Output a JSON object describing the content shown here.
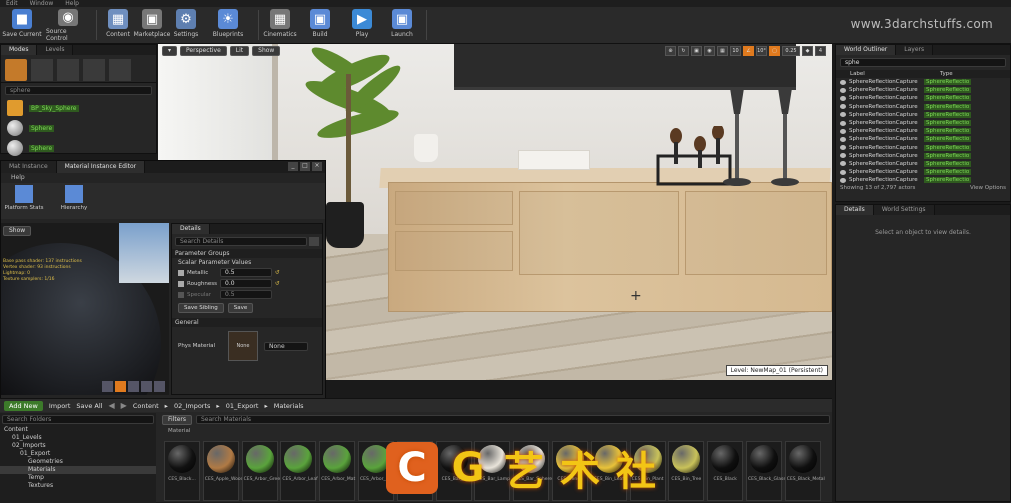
{
  "menu": [
    "Edit",
    "Window",
    "Help"
  ],
  "toolbar": {
    "buttons": [
      {
        "label": "Save Current",
        "color": "#4a7fd1"
      },
      {
        "label": "Source Control",
        "color": "#8a8a8a"
      },
      {
        "label": "Content",
        "color": "#6f8fbf"
      },
      {
        "label": "Marketplace",
        "color": "#7a7a7a"
      },
      {
        "label": "Settings",
        "color": "#5e7fb0"
      },
      {
        "label": "Blueprints",
        "color": "#5b8ad6"
      },
      {
        "label": "Cinematics",
        "color": "#8a8a8a"
      },
      {
        "label": "Build",
        "color": "#5b8ad6"
      },
      {
        "label": "Play",
        "color": "#3c8ad6"
      },
      {
        "label": "Launch",
        "color": "#5b8ad6"
      }
    ]
  },
  "brand": "www.3darchstuffs.com",
  "modes": {
    "tabs": [
      "Modes",
      "Levels"
    ],
    "search": "sphere",
    "items": [
      {
        "label": "BP_Sky_Sphere"
      },
      {
        "label": "Sphere"
      },
      {
        "label": "Sphere"
      }
    ]
  },
  "floating": {
    "tabs": [
      "Mat Instance",
      "Material Instance Editor"
    ],
    "menu": "Help",
    "tools": [
      {
        "label": "Platform Stats"
      },
      {
        "label": "Hierarchy"
      }
    ],
    "preview_btn": "Show",
    "stats": [
      "Base pass shader: 137 instructions",
      "Vertex shader: 93 instructions",
      "Lightmap: 0",
      "Texture samplers: 1/16"
    ],
    "details_tab": "Details",
    "details_search": "Search Details",
    "section_param": "Parameter Groups",
    "group_scalar": "Scalar Parameter Values",
    "params": [
      {
        "name": "Metallic",
        "value": "0.5"
      },
      {
        "name": "Roughness",
        "value": "0.0"
      },
      {
        "name": "Specular",
        "value": "0.5"
      }
    ],
    "save_sibling": "Save Sibling",
    "save_child": "Save",
    "section_general": "General",
    "phys_label": "Phys Material",
    "phys_value": "None",
    "thumb": "None"
  },
  "viewport": {
    "perspective": "Perspective",
    "lit": "Lit",
    "show": "Show",
    "right_values": [
      "10",
      "10°",
      "0.25",
      "4"
    ],
    "level": "Level:  NewMap_01 (Persistent)"
  },
  "outliner": {
    "tabs": [
      "World Outliner",
      "Layers"
    ],
    "search": "sphe",
    "col_label": "Label",
    "col_type": "Type",
    "rows": [
      {
        "label": "SphereReflectionCapture",
        "type": "SphereReflectio"
      },
      {
        "label": "SphereReflectionCapture",
        "type": "SphereReflectio"
      },
      {
        "label": "SphereReflectionCapture",
        "type": "SphereReflectio"
      },
      {
        "label": "SphereReflectionCapture",
        "type": "SphereReflectio"
      },
      {
        "label": "SphereReflectionCapture",
        "type": "SphereReflectio"
      },
      {
        "label": "SphereReflectionCapture",
        "type": "SphereReflectio"
      },
      {
        "label": "SphereReflectionCapture",
        "type": "SphereReflectio"
      },
      {
        "label": "SphereReflectionCapture",
        "type": "SphereReflectio"
      },
      {
        "label": "SphereReflectionCapture",
        "type": "SphereReflectio"
      },
      {
        "label": "SphereReflectionCapture",
        "type": "SphereReflectio"
      },
      {
        "label": "SphereReflectionCapture",
        "type": "SphereReflectio"
      },
      {
        "label": "SphereReflectionCapture",
        "type": "SphereReflectio"
      },
      {
        "label": "SphereReflectionCapture",
        "type": "SphereReflectio"
      }
    ],
    "footer": "Showing 13 of 2,797 actors",
    "view_options": "View Options"
  },
  "rdetails": {
    "tabs": [
      "Details",
      "World Settings"
    ],
    "hint": "Select an object to view details."
  },
  "cbrowser": {
    "add_new": "Add New",
    "import": "Import",
    "save_all": "Save All",
    "path": [
      "Content",
      "02_Imports",
      "01_Export",
      "Materials"
    ],
    "search_folders": "Search Folders",
    "filters": "Filters",
    "search_assets": "Search Materials",
    "crumb": "Material",
    "tree": [
      {
        "label": "Content",
        "sel": false
      },
      {
        "label": "01_Levels",
        "sel": false
      },
      {
        "label": "02_Imports",
        "sel": false
      },
      {
        "label": "01_Export",
        "sel": false
      },
      {
        "label": "Geometries",
        "sel": false
      },
      {
        "label": "Materials",
        "sel": true
      },
      {
        "label": "Temp",
        "sel": false
      },
      {
        "label": "Textures",
        "sel": false
      }
    ],
    "assets": [
      {
        "name": "CES_Black...",
        "color": "#111"
      },
      {
        "name": "CES_Apple_Wood",
        "color": "#b07a45"
      },
      {
        "name": "CES_Arbor_Green",
        "color": "#5aa33c"
      },
      {
        "name": "CES_Arbor_Leaf",
        "color": "#5aa33c"
      },
      {
        "name": "CES_Arbor_Mat",
        "color": "#5aa33c"
      },
      {
        "name": "CES_Arbor_Plant",
        "color": "#5aa33c"
      },
      {
        "name": "CES_Background",
        "color": "#e9e4da"
      },
      {
        "name": "CES_Bar_2",
        "color": "#111"
      },
      {
        "name": "CES_Bar_Lamp",
        "color": "#e9e4da"
      },
      {
        "name": "CES_Bar_Sphere",
        "color": "#e9e4da"
      },
      {
        "name": "CES_Bench",
        "color": "#e9c33a"
      },
      {
        "name": "CES_Bin_Leaf",
        "color": "#e9c33a"
      },
      {
        "name": "CES_Bin_Plant",
        "color": "#c9c25a"
      },
      {
        "name": "CES_Bin_Tree",
        "color": "#c9c25a"
      },
      {
        "name": "CES_Black",
        "color": "#0f0f0f"
      },
      {
        "name": "CES_Black_Glass",
        "color": "#0f0f0f"
      },
      {
        "name": "CES_Black_Metal",
        "color": "#0f0f0f"
      }
    ]
  }
}
